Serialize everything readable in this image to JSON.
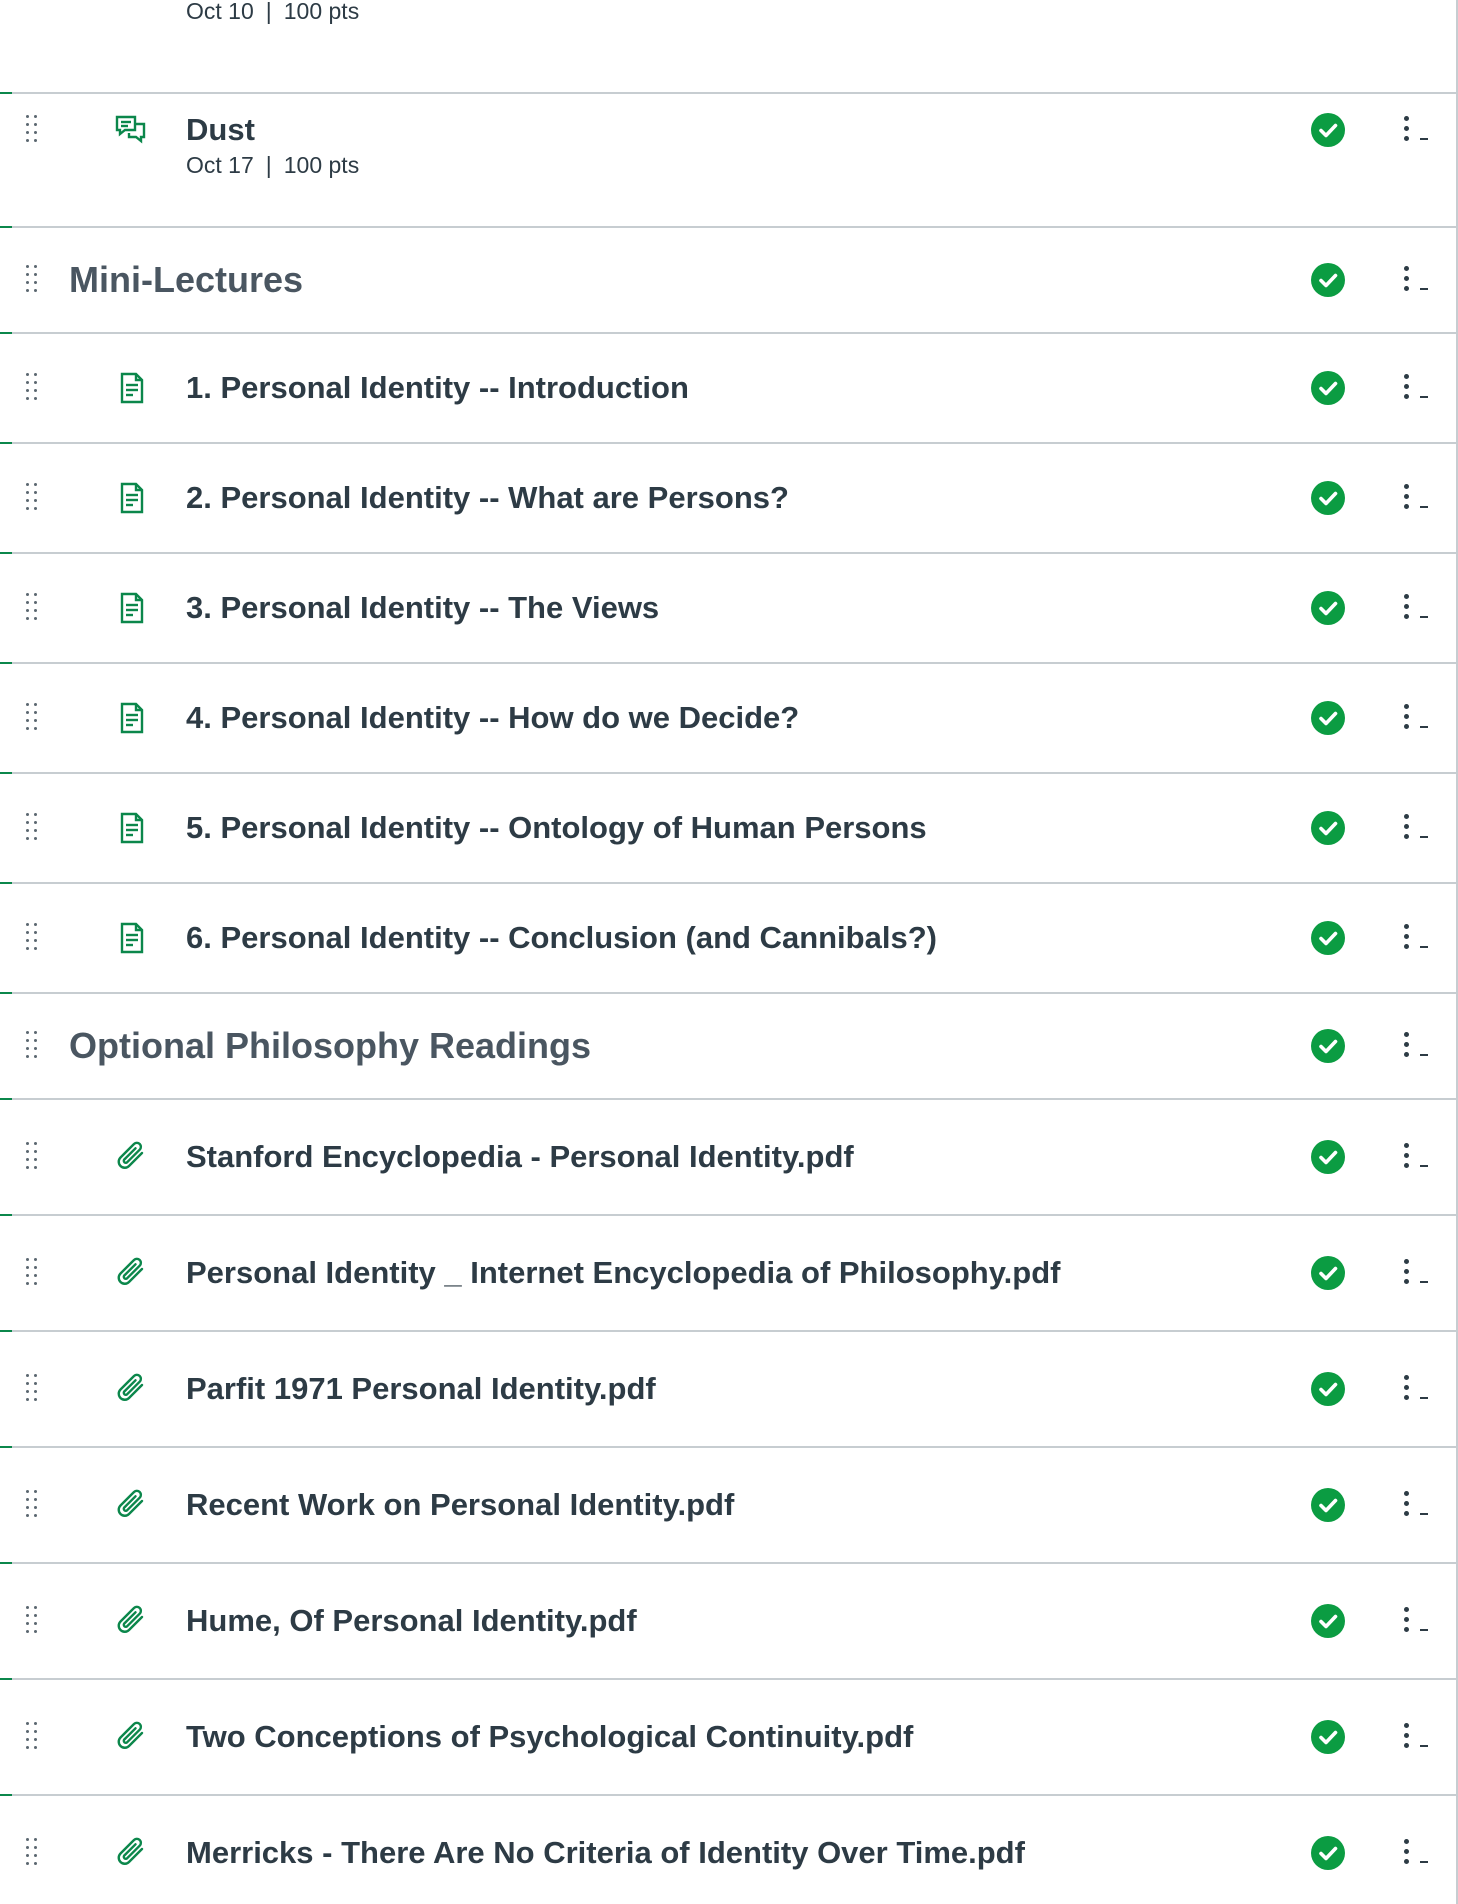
{
  "rows": [
    {
      "kind": "item",
      "icon": "discussion-icon",
      "title": "",
      "date": "Oct 10",
      "points": "100 pts",
      "published": true
    },
    {
      "kind": "item",
      "icon": "discussion-icon",
      "title": "Dust",
      "date": "Oct 17",
      "points": "100 pts",
      "published": true
    },
    {
      "kind": "header",
      "title": "Mini-Lectures",
      "published": true
    },
    {
      "kind": "item",
      "icon": "page-icon",
      "title": "1. Personal Identity -- Introduction",
      "published": true
    },
    {
      "kind": "item",
      "icon": "page-icon",
      "title": "2. Personal Identity -- What are Persons?",
      "published": true
    },
    {
      "kind": "item",
      "icon": "page-icon",
      "title": "3. Personal Identity -- The Views",
      "published": true
    },
    {
      "kind": "item",
      "icon": "page-icon",
      "title": "4. Personal Identity -- How do we Decide?",
      "published": true
    },
    {
      "kind": "item",
      "icon": "page-icon",
      "title": "5. Personal Identity -- Ontology of Human Persons",
      "published": true
    },
    {
      "kind": "item",
      "icon": "page-icon",
      "title": "6. Personal Identity -- Conclusion (and Cannibals?)",
      "published": true
    },
    {
      "kind": "header",
      "title": "Optional Philosophy Readings",
      "published": true
    },
    {
      "kind": "item",
      "icon": "attachment-icon",
      "title": "Stanford Encyclopedia - Personal Identity.pdf",
      "published": true
    },
    {
      "kind": "item",
      "icon": "attachment-icon",
      "title": "Personal Identity _ Internet Encyclopedia of Philosophy.pdf",
      "published": true
    },
    {
      "kind": "item",
      "icon": "attachment-icon",
      "title": "Parfit 1971 Personal Identity.pdf",
      "published": true
    },
    {
      "kind": "item",
      "icon": "attachment-icon",
      "title": "Recent Work on Personal Identity.pdf",
      "published": true
    },
    {
      "kind": "item",
      "icon": "attachment-icon",
      "title": "Hume, Of Personal Identity.pdf",
      "published": true
    },
    {
      "kind": "item",
      "icon": "attachment-icon",
      "title": "Two Conceptions of Psychological Continuity.pdf",
      "published": true
    },
    {
      "kind": "item",
      "icon": "attachment-icon",
      "title": "Merricks - There Are No Criteria of Identity Over Time.pdf",
      "published": true
    }
  ],
  "colors": {
    "accent": "#0b874b",
    "published": "#0b9c42",
    "text": "#2d3b45",
    "header_text": "#4a5661",
    "border": "#c7cdd1"
  }
}
